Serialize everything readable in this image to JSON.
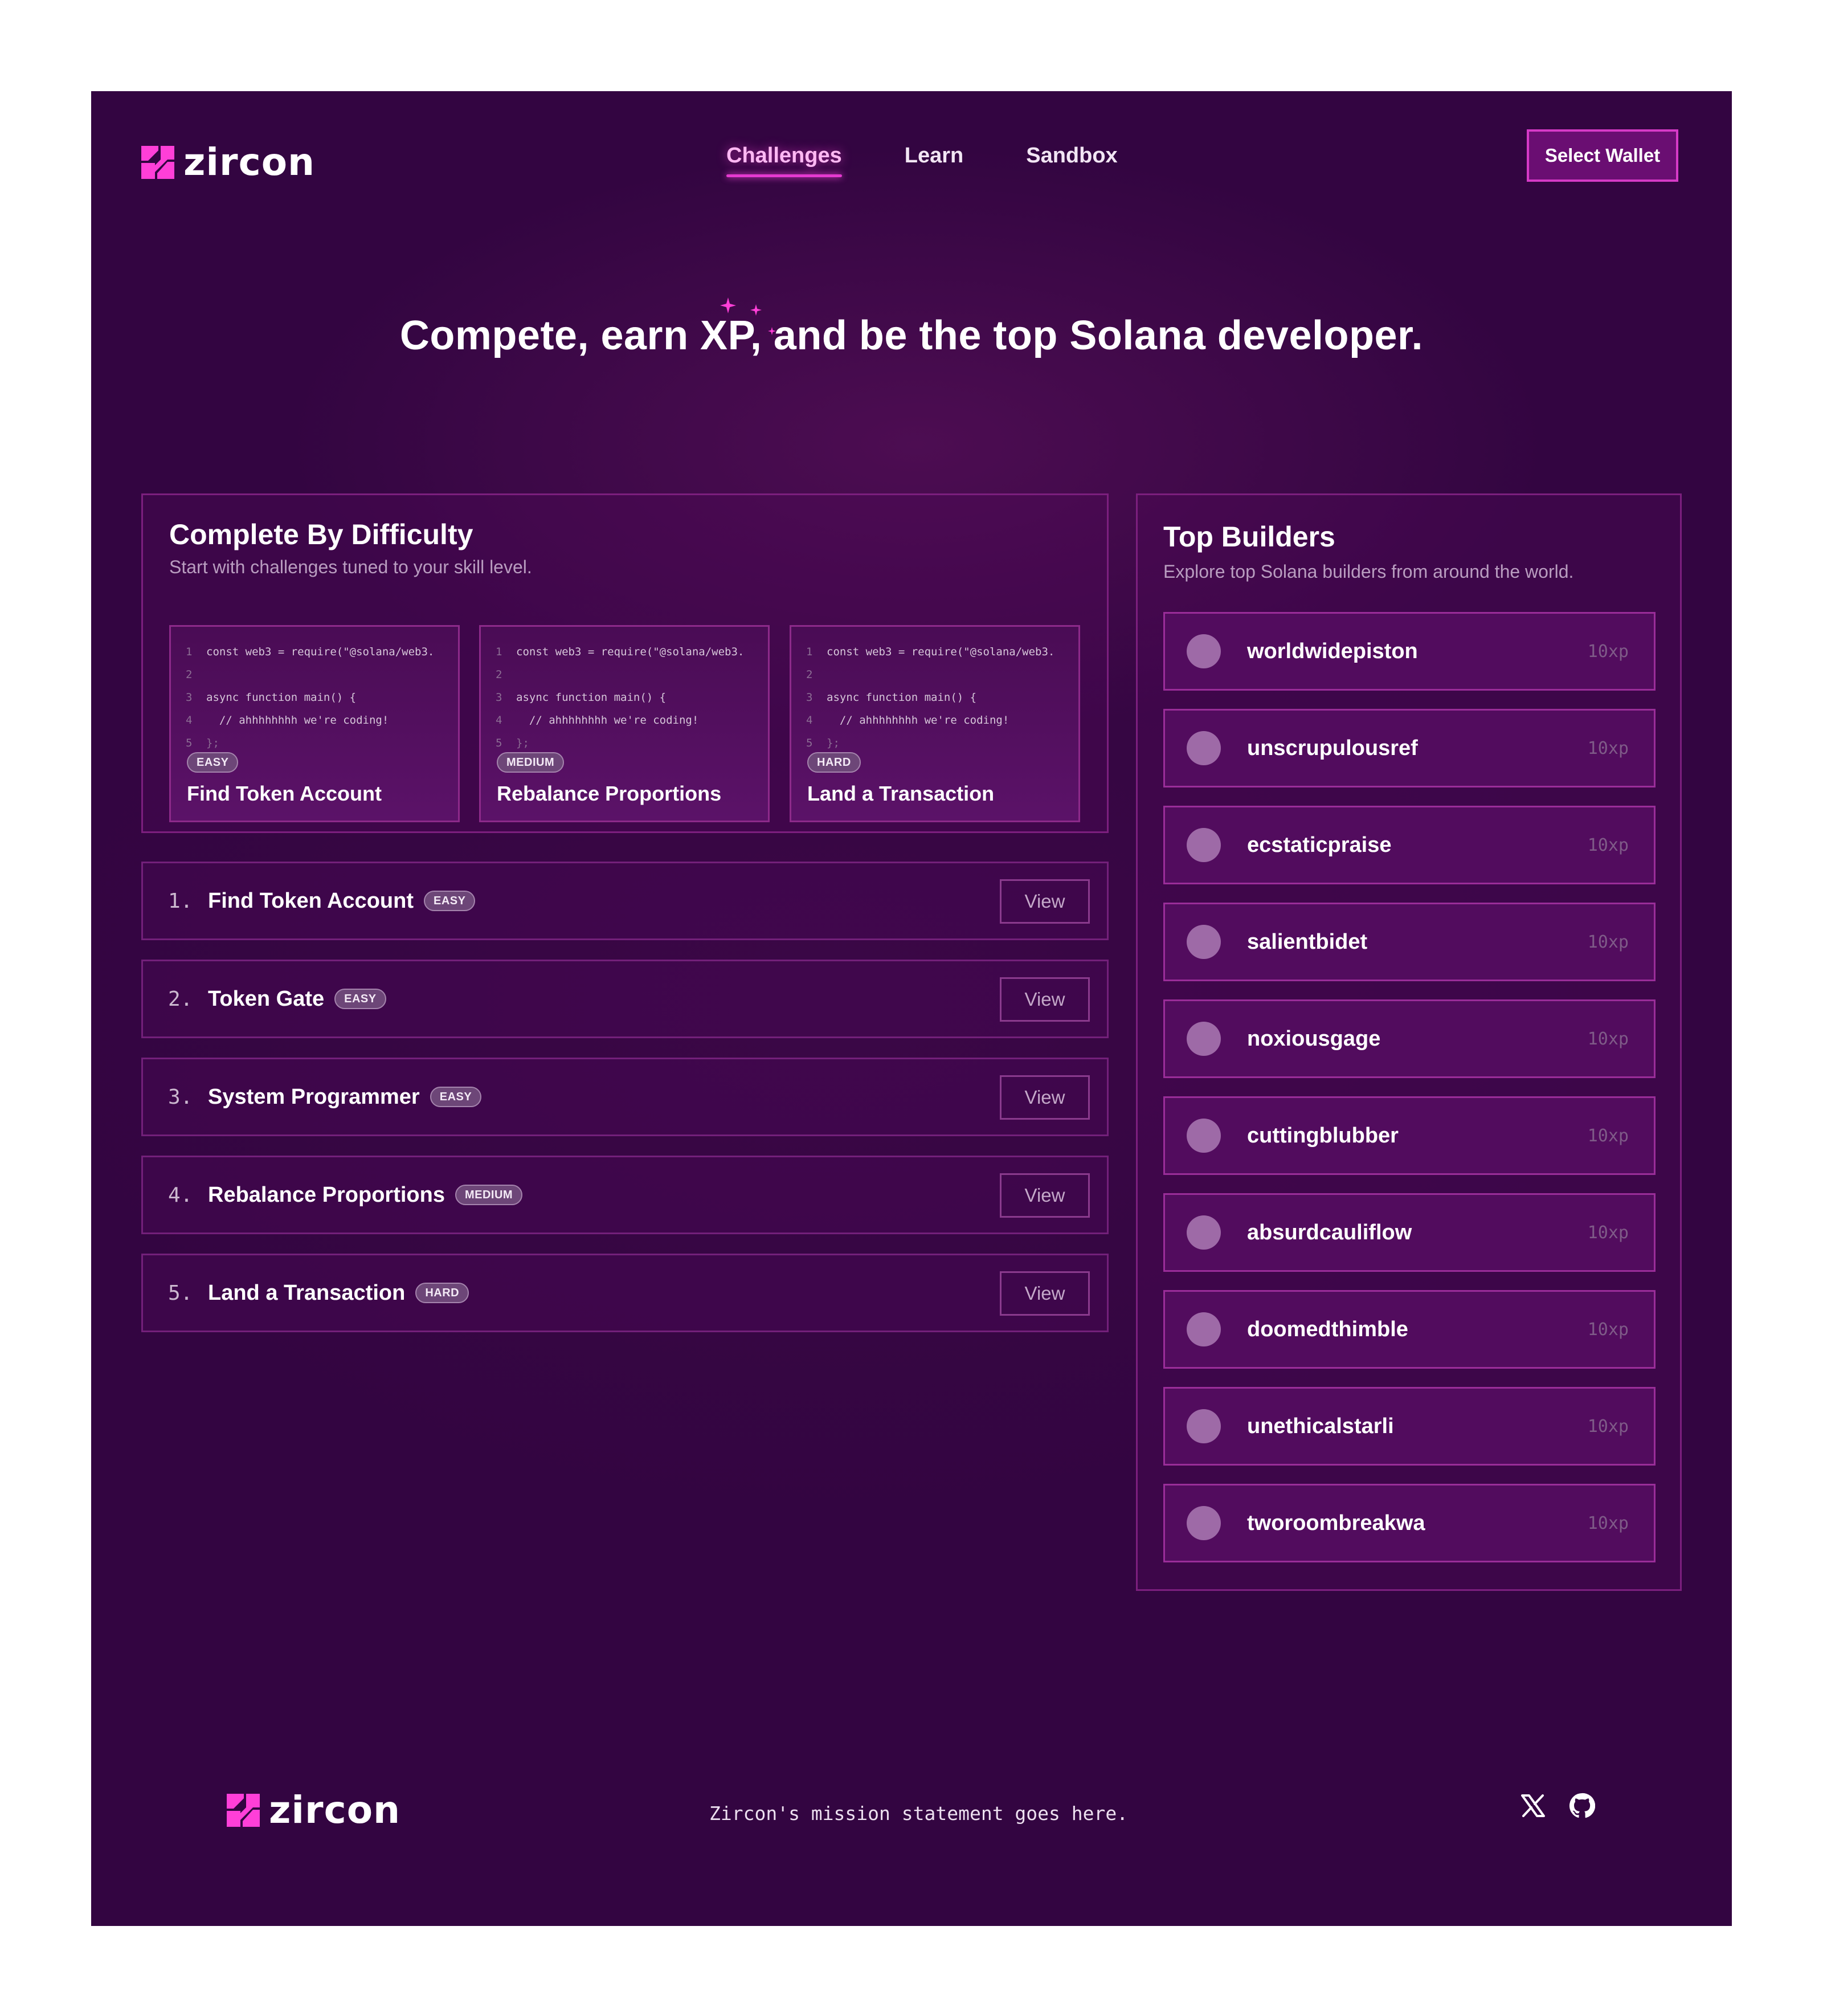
{
  "brand": {
    "name": "zircon",
    "accent": "#e43ad0",
    "background": "#330541"
  },
  "nav": {
    "items": [
      {
        "label": "Challenges",
        "active": true
      },
      {
        "label": "Learn",
        "active": false
      },
      {
        "label": "Sandbox",
        "active": false
      }
    ],
    "wallet_button": "Select Wallet"
  },
  "hero": {
    "headline": "Compete, earn XP, and be the top Solana developer."
  },
  "difficulty": {
    "title": "Complete By Difficulty",
    "subtitle": "Start with challenges tuned to your skill level.",
    "code_lines": [
      {
        "n": "1",
        "text": "const web3 = require(\"@solana/web3."
      },
      {
        "n": "2",
        "text": ""
      },
      {
        "n": "3",
        "text": "async function main() {"
      },
      {
        "n": "4",
        "text": "  // ahhhhhhhh we're coding!"
      },
      {
        "n": "5",
        "text": "};"
      }
    ],
    "cards": [
      {
        "badge": "EASY",
        "title": "Find Token Account"
      },
      {
        "badge": "MEDIUM",
        "title": "Rebalance Proportions"
      },
      {
        "badge": "HARD",
        "title": "Land a  Transaction"
      }
    ]
  },
  "challenges": {
    "view_label": "View",
    "items": [
      {
        "num": "1.",
        "title": "Find Token Account",
        "badge": "EASY"
      },
      {
        "num": "2.",
        "title": "Token Gate",
        "badge": "EASY"
      },
      {
        "num": "3.",
        "title": "System Programmer",
        "badge": "EASY"
      },
      {
        "num": "4.",
        "title": "Rebalance Proportions",
        "badge": "MEDIUM"
      },
      {
        "num": "5.",
        "title": "Land a Transaction",
        "badge": "HARD"
      }
    ]
  },
  "builders": {
    "title": "Top Builders",
    "subtitle": "Explore top Solana builders from around the world.",
    "items": [
      {
        "name": "worldwidepiston",
        "xp": "10xp"
      },
      {
        "name": "unscrupulousref",
        "xp": "10xp"
      },
      {
        "name": "ecstaticpraise",
        "xp": "10xp"
      },
      {
        "name": "salientbidet",
        "xp": "10xp"
      },
      {
        "name": "noxiousgage",
        "xp": "10xp"
      },
      {
        "name": "cuttingblubber",
        "xp": "10xp"
      },
      {
        "name": "absurdcauliflow",
        "xp": "10xp"
      },
      {
        "name": "doomedthimble",
        "xp": "10xp"
      },
      {
        "name": "unethicalstarli",
        "xp": "10xp"
      },
      {
        "name": "tworoombreakwa",
        "xp": "10xp"
      }
    ]
  },
  "footer": {
    "mission": "Zircon's mission statement goes here.",
    "social_icons": [
      "x-icon",
      "github-icon"
    ]
  }
}
